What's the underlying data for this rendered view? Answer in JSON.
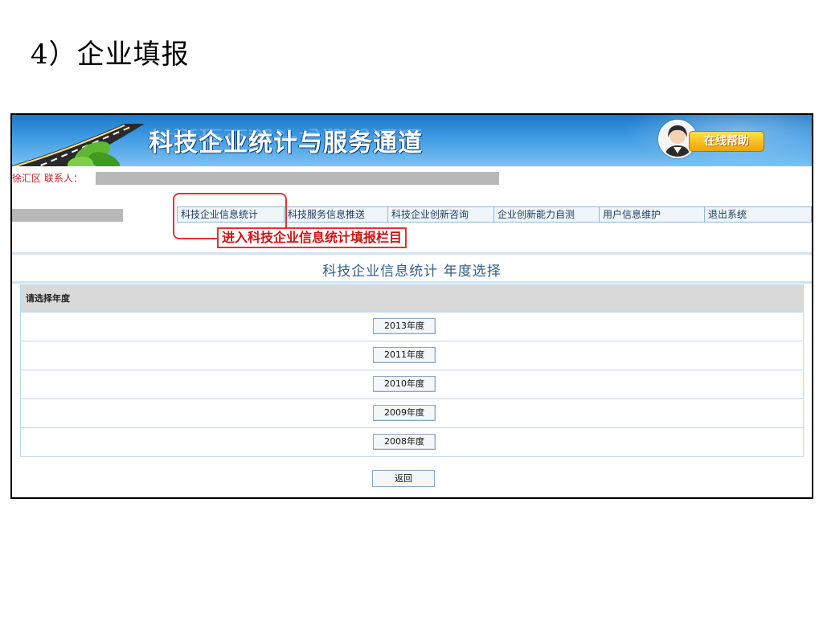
{
  "slide": {
    "title": "4）企业填报"
  },
  "banner": {
    "title": "科技企业统计与服务通道",
    "help_label": "在线帮助",
    "colors": {
      "sky": "#1e78c8",
      "help": "#f1a400"
    }
  },
  "contact": {
    "text": "徐汇区 联系人："
  },
  "menu": {
    "items": [
      {
        "label": "科技企业信息统计"
      },
      {
        "label": "科技服务信息推送"
      },
      {
        "label": "科技企业创新咨询"
      },
      {
        "label": "企业创新能力自测"
      },
      {
        "label": "用户信息维护"
      },
      {
        "label": "退出系统"
      }
    ]
  },
  "annotation": {
    "callout": "进入科技企业信息统计填报栏目",
    "color": "#e53232"
  },
  "section": {
    "title": "科技企业信息统计 年度选择"
  },
  "years": {
    "header": "请选择年度",
    "options": [
      "2013年度",
      "2011年度",
      "2010年度",
      "2009年度",
      "2008年度"
    ]
  },
  "back_label": "返回"
}
